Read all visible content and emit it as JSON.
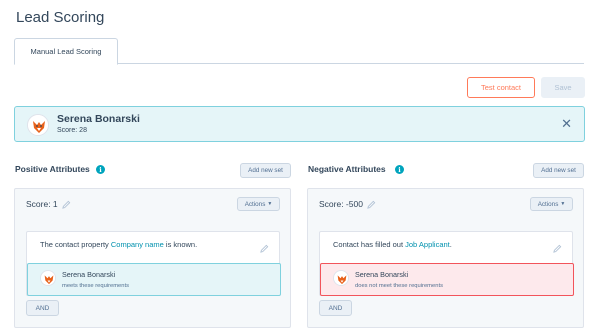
{
  "page": {
    "title": "Lead Scoring"
  },
  "tabs": [
    {
      "label": "Manual Lead Scoring",
      "active": true
    }
  ],
  "toolbar": {
    "test_contact_label": "Test contact",
    "save_label": "Save"
  },
  "contact": {
    "name": "Serena Bonarski",
    "score_text": "Score: 28",
    "avatar_icon": "fox-avatar-icon"
  },
  "positive": {
    "title": "Positive Attributes",
    "add_new_set_label": "Add new set",
    "set_score": "Score: 1",
    "actions_label": "Actions",
    "criteria_prefix": "The contact property ",
    "criteria_link": "Company name",
    "criteria_suffix": " is known.",
    "result_name": "Serena Bonarski",
    "result_status": "meets these requirements",
    "and_label": "AND"
  },
  "negative": {
    "title": "Negative Attributes",
    "add_new_set_label": "Add new set",
    "set_score": "Score: -500",
    "actions_label": "Actions",
    "criteria_prefix": "Contact has filled out ",
    "criteria_link": "Job Applicant",
    "criteria_suffix": ".",
    "result_name": "Serena Bonarski",
    "result_status": "does not meet these requirements",
    "and_label": "AND"
  },
  "colors": {
    "accent_orange": "#ff7a59",
    "teal": "#00a4bd",
    "link": "#0091ae",
    "positive_bg": "#e5f5f8",
    "negative_bg": "#fde9ec",
    "text": "#33475b"
  }
}
